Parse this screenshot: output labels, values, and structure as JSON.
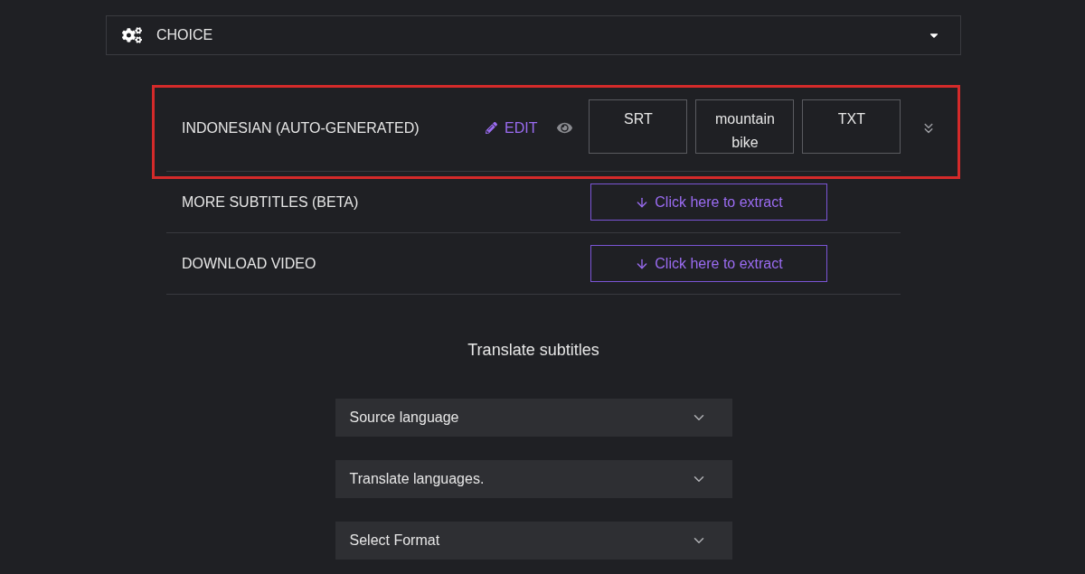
{
  "choice_bar": {
    "label": "CHOICE",
    "expanded": true
  },
  "subtitle_row": {
    "language": "INDONESIAN (AUTO-GENERATED)",
    "highlighted": true,
    "edit": "EDIT",
    "formats": [
      "SRT",
      "mountain bike",
      "TXT"
    ]
  },
  "extract_rows": [
    {
      "label": "MORE SUBTITLES (BETA)",
      "button": "Click here to extract"
    },
    {
      "label": "DOWNLOAD VIDEO",
      "button": "Click here to extract"
    }
  ],
  "translate": {
    "title": "Translate subtitles",
    "selects": [
      "Source language",
      "Translate languages.",
      "Select Format"
    ]
  }
}
